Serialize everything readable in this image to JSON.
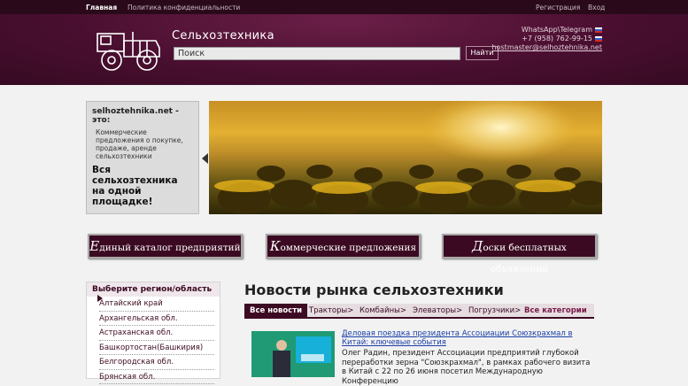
{
  "topnav": {
    "home": "Главная",
    "policy": "Политика конфиденциальности",
    "register": "Регистрация",
    "login": "Вход"
  },
  "header": {
    "site_title": "Сельхозтехника",
    "search_placeholder": "Поиск",
    "search_button": "Найти",
    "contact_line1": "WhatsApp\\Telegram",
    "phone": "+7 (958) 762-99-15",
    "email": "hostmaster@selhoztehnika.net"
  },
  "promo": {
    "title": "selhoztehnika.net - это:",
    "text": "Коммерческие предложения о покупке, продаже, аренде сельхозтехники",
    "bold": "Вся сельхозтехника на одной площадке!"
  },
  "categories": [
    {
      "cap": "Е",
      "rest": "диный каталог предприятий"
    },
    {
      "cap": "К",
      "rest": "оммерческие предложения"
    },
    {
      "cap": "Д",
      "rest": "оски бесплатных объявлений"
    }
  ],
  "regions": {
    "title": "Выберите регион/область",
    "items": [
      "Алтайский край",
      "Архангельская обл.",
      "Астраханская обл.",
      "Башкортостан(Башкирия)",
      "Белгородская обл.",
      "Брянская обл."
    ]
  },
  "news": {
    "title": "Новости рынка сельхозтехники",
    "tabs": [
      "Все новости",
      "Тракторы>",
      "Комбайны>",
      "Элеваторы>",
      "Погрузчики>",
      "Все категории"
    ],
    "headline": "Деловая поездка президента Ассоциации Союзкрахмал в Китай: ключевые события",
    "body": "Олег Радин, президент Ассоциации предприятий глубокой переработки зерна \"Союзкрахмал\", в рамках рабочего визита в Китай с 22 по 26 июня посетил Международную Конференцию"
  },
  "colors": {
    "brand": "#4a0f30",
    "topnav": "#2a0a1a",
    "link": "#1a3fa8"
  }
}
